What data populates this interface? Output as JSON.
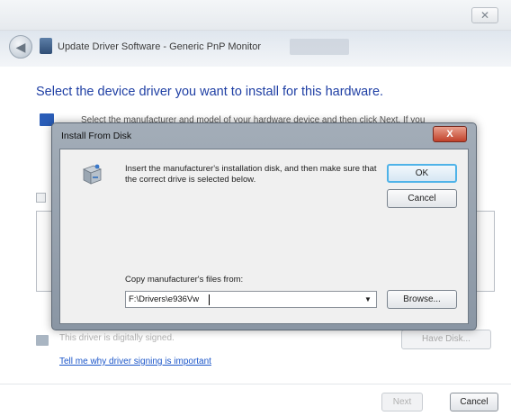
{
  "outer_window": {
    "close_glyph": "✕",
    "title": "Update Driver Software - Generic PnP Monitor",
    "back_glyph": "◀",
    "heading": "Select the device driver you want to install for this hardware.",
    "description": "Select the manufacturer and model of your hardware device and then click Next. If you",
    "unsigned_text": "This driver is digitally signed.",
    "signing_link": "Tell me why driver signing is important",
    "have_disk_label": "Have Disk...",
    "next_label": "Next",
    "cancel_label": "Cancel"
  },
  "dialog": {
    "title": "Install From Disk",
    "close_glyph": "X",
    "message": "Insert the manufacturer's installation disk, and then make sure that the correct drive is selected below.",
    "ok_label": "OK",
    "cancel_label": "Cancel",
    "copy_label": "Copy manufacturer's files from:",
    "path_value": "F:\\Drivers\\e936Vw",
    "dropdown_glyph": "▼",
    "browse_label": "Browse..."
  },
  "icons": {
    "dialog_icon": "disk-drive-icon",
    "back_icon": "back-arrow-icon",
    "close_icon": "close-icon"
  },
  "colors": {
    "heading_blue": "#1f3fa4",
    "link_blue": "#1a55c9",
    "close_red": "#c1412a",
    "ok_focus": "#4fb3e8"
  }
}
